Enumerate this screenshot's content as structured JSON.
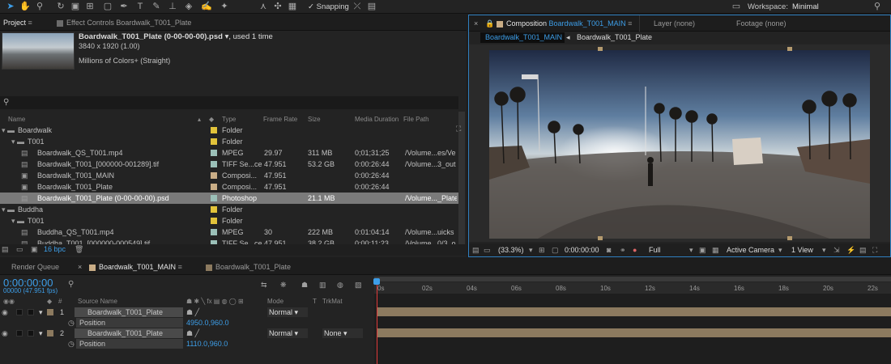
{
  "toolbar": {
    "snapping": "Snapping",
    "workspace_label": "Workspace:",
    "workspace_value": "Minimal"
  },
  "project_panel": {
    "tab_project": "Project",
    "tab_effect_controls": "Effect Controls Boardwalk_T001_Plate",
    "item_name": "Boardwalk_T001_Plate (0-00-00-00).psd",
    "item_usage": ", used 1 time",
    "item_dims": "3840 x 1920 (1.00)",
    "item_colors": "Millions of Colors+ (Straight)",
    "search_placeholder": "",
    "headers": {
      "name": "Name",
      "type": "Type",
      "frame_rate": "Frame Rate",
      "size": "Size",
      "media_duration": "Media Duration",
      "file_path": "File Path"
    },
    "rows": [
      {
        "name": "Boardwalk",
        "type": "Folder",
        "fps": "",
        "size": "",
        "dur": "",
        "path": "",
        "color": "#e2c33a"
      },
      {
        "name": "T001",
        "type": "Folder",
        "fps": "",
        "size": "",
        "dur": "",
        "path": "",
        "color": "#e2c33a"
      },
      {
        "name": "Boardwalk_QS_T001.mp4",
        "type": "MPEG",
        "fps": "29.97",
        "size": "311 MB",
        "dur": "0;01;31;25",
        "path": "/Volume...es/Ve",
        "color": "#9bc0b8"
      },
      {
        "name": "Boardwalk_T001_[000000-001289].tif",
        "type": "TIFF Se...ce",
        "fps": "47.951",
        "size": "53.2 GB",
        "dur": "0:00:26:44",
        "path": "/Volume...3_out",
        "color": "#9bc0b8"
      },
      {
        "name": "Boardwalk_T001_MAIN",
        "type": "Composi...",
        "fps": "47.951",
        "size": "",
        "dur": "0:00:26:44",
        "path": "",
        "color": "#c9ad86"
      },
      {
        "name": "Boardwalk_T001_Plate",
        "type": "Composi...",
        "fps": "47.951",
        "size": "",
        "dur": "0:00:26:44",
        "path": "",
        "color": "#c9ad86"
      },
      {
        "name": "Boardwalk_T001_Plate (0-00-00-00).psd",
        "type": "Photoshop",
        "fps": "",
        "size": "21.1 MB",
        "dur": "",
        "path": "/Volume..._Plate",
        "color": "#9bc0b8"
      },
      {
        "name": "Buddha",
        "type": "Folder",
        "fps": "",
        "size": "",
        "dur": "",
        "path": "",
        "color": "#e2c33a"
      },
      {
        "name": "T001",
        "type": "Folder",
        "fps": "",
        "size": "",
        "dur": "",
        "path": "",
        "color": "#e2c33a"
      },
      {
        "name": "Buddha_QS_T001.mp4",
        "type": "MPEG",
        "fps": "30",
        "size": "222 MB",
        "dur": "0:01:04:14",
        "path": "/Volume...uicks",
        "color": "#9bc0b8"
      },
      {
        "name": "Buddha_T001_[000000-000549].tif",
        "type": "TIFF Se...ce",
        "fps": "47.951",
        "size": "38.2 GB",
        "dur": "0:00:11:23",
        "path": "/Volume...0/3_o",
        "color": "#9bc0b8"
      }
    ],
    "bpc": "16 bpc"
  },
  "comp_panel": {
    "tab_comp_prefix": "Composition",
    "tab_comp_name": "Boardwalk_T001_MAIN",
    "tab_layer": "Layer (none)",
    "tab_footage": "Footage (none)",
    "crumb_main": "Boardwalk_T001_MAIN",
    "crumb_plate": "Boardwalk_T001_Plate",
    "zoom": "(33.3%)",
    "timecode": "0:00:00:00",
    "resolution": "Full",
    "camera": "Active Camera",
    "views": "1 View"
  },
  "timeline": {
    "tab_render_queue": "Render Queue",
    "tab_main": "Boardwalk_T001_MAIN",
    "tab_plate": "Boardwalk_T001_Plate",
    "timecode": "0:00:00:00",
    "frame_info": "00000 (47.951 fps)",
    "col_source": "Source Name",
    "col_mode": "Mode",
    "col_t": "T",
    "col_trkmat": "TrkMat",
    "ruler": [
      "0s",
      "02s",
      "04s",
      "06s",
      "08s",
      "10s",
      "12s",
      "14s",
      "16s",
      "18s",
      "20s",
      "22s"
    ],
    "layers": [
      {
        "num": "1",
        "name": "Boardwalk_T001_Plate",
        "mode": "Normal",
        "trkmat": "",
        "prop": "Position",
        "value": "4950.0,960.0"
      },
      {
        "num": "2",
        "name": "Boardwalk_T001_Plate",
        "mode": "Normal",
        "trkmat": "None",
        "prop": "Position",
        "value": "1110.0,960.0"
      }
    ]
  },
  "colors": {
    "accent": "#3d9ee8",
    "layer_bar": "#8c7a5f",
    "folder_label": "#e2c33a",
    "comp_label": "#c9ad86",
    "footage_label": "#9bc0b8"
  }
}
